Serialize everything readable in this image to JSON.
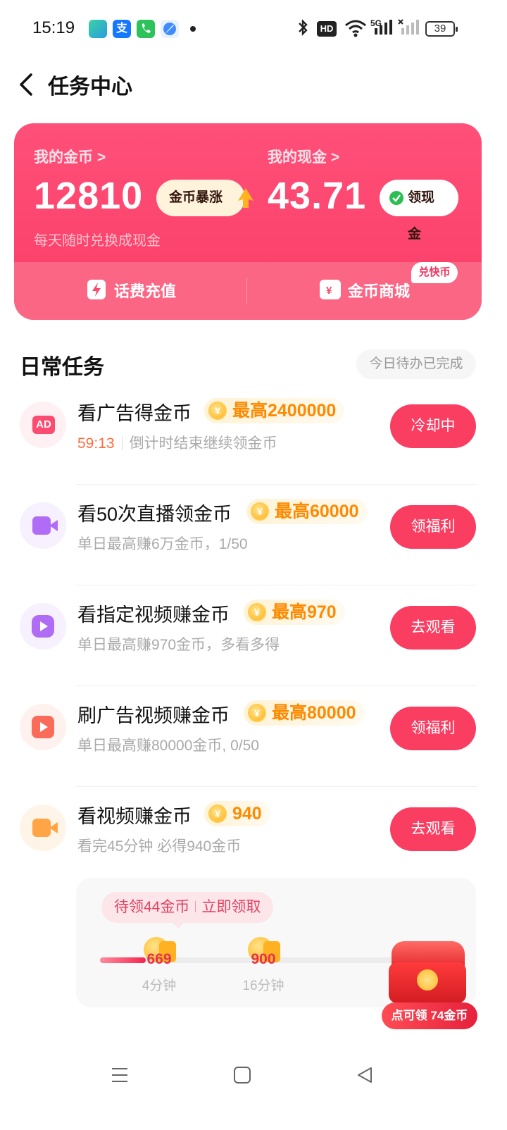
{
  "status_bar": {
    "time": "15:19",
    "apps": [
      "signal-app-icon",
      "alipay-icon",
      "phone-icon",
      "browser-icon"
    ],
    "alipay_glyph": "支",
    "hd_label": "HD",
    "net_label": "5G",
    "battery": "39"
  },
  "header": {
    "title": "任务中心"
  },
  "wallet": {
    "coins_label": "我的金币 >",
    "coins_value": "12810",
    "boom_label": "金币暴涨",
    "cash_label": "我的现金 >",
    "cash_value": "43.71",
    "cash_button": "领现金",
    "subtitle": "每天随时兑换成现金",
    "recharge_label": "话费充值",
    "mall_label": "金币商城",
    "mall_tag": "兑快币",
    "accent": "#fb3d67"
  },
  "daily": {
    "title": "日常任务",
    "badge": "今日待办已完成",
    "tasks": [
      {
        "name": "看广告得金币",
        "reward": "最高2400000",
        "countdown": "59:13",
        "desc": "倒计时结束继续领金币",
        "button": "冷却中",
        "icon": "ad-icon"
      },
      {
        "name": "看50次直播领金币",
        "reward": "最高60000",
        "desc": "单日最高赚6万金币，1/50",
        "button": "领福利",
        "icon": "live-camera-icon"
      },
      {
        "name": "看指定视频赚金币",
        "reward": "最高970",
        "desc": "单日最高赚970金币，多看多得",
        "button": "去观看",
        "icon": "play-video-icon"
      },
      {
        "name": "刷广告视频赚金币",
        "reward": "最高80000",
        "desc": "单日最高赚80000金币, 0/50",
        "button": "领福利",
        "icon": "ad-video-icon"
      },
      {
        "name": "看视频赚金币",
        "reward": "940",
        "desc": "看完45分钟 必得940金币",
        "button": "去观看",
        "icon": "video-camera-icon"
      }
    ],
    "coin_glyph": "¥"
  },
  "progress": {
    "pending_text": "待领44金币",
    "claim_text": "立即领取",
    "fill_fraction": 0.15,
    "nodes": [
      {
        "value": "669",
        "minutes": "4分钟"
      },
      {
        "value": "900",
        "minutes": "16分钟"
      }
    ],
    "chest_label": "点可领 74金币"
  }
}
